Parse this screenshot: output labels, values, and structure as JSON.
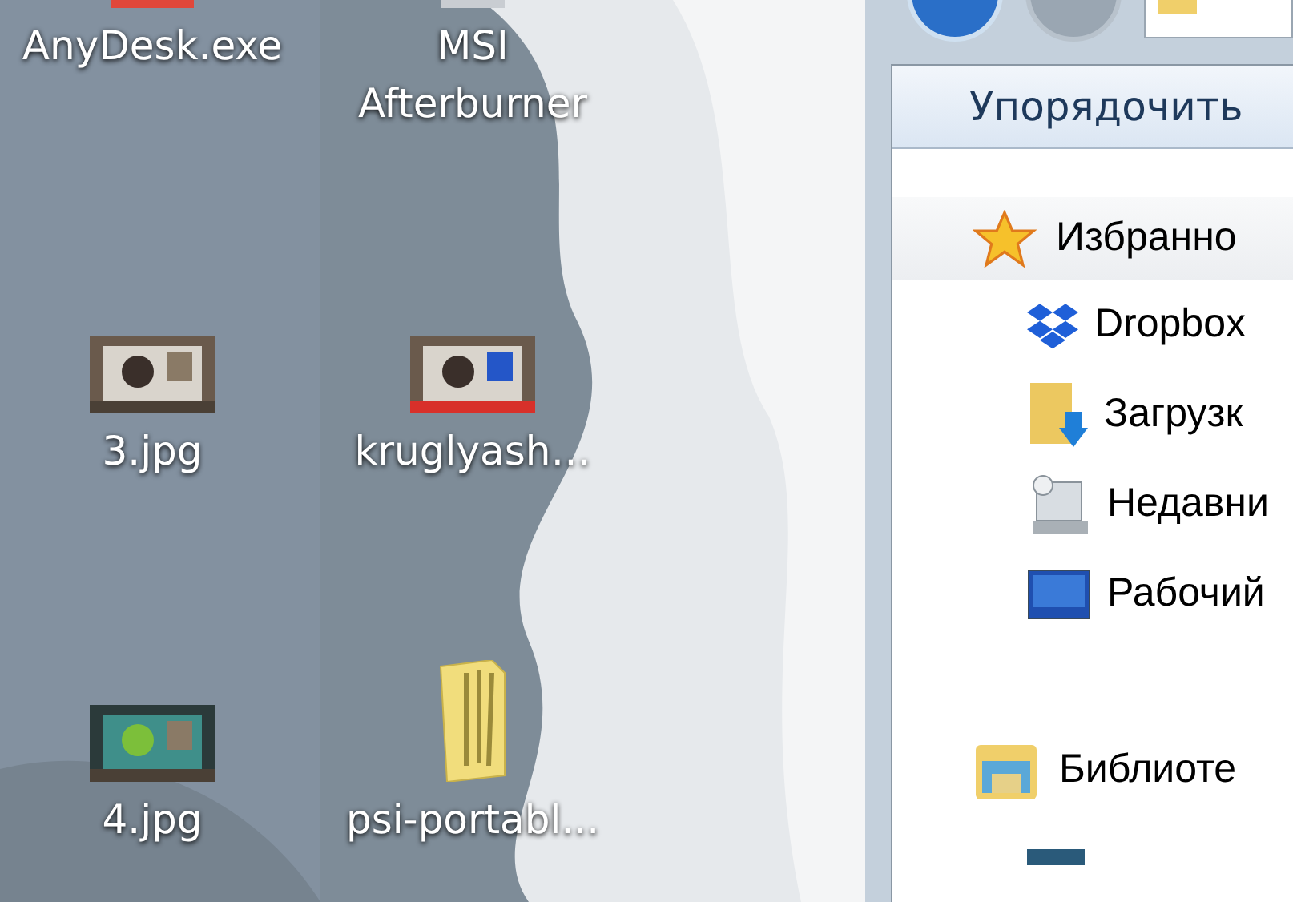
{
  "desktop": {
    "icons": [
      {
        "label": "AnyDesk.exe",
        "kind": "app"
      },
      {
        "label": "MSI Afterburner",
        "kind": "app"
      },
      {
        "label": "3.jpg"
      },
      {
        "label": "kruglyash…"
      },
      {
        "label": "4.jpg"
      },
      {
        "label": "psi-portabl...",
        "kind": "folder"
      }
    ]
  },
  "explorer": {
    "toolbar": {
      "organize": "Упорядочить"
    },
    "navigation": [
      {
        "label": "Избранно",
        "children": [
          {
            "label": "Dropbox",
            "kind": "item"
          },
          {
            "label": "Загрузк",
            "kind": "item"
          },
          {
            "label": "Недавни",
            "kind": "item"
          },
          {
            "label": "Рабочий",
            "kind": "item"
          }
        ]
      },
      {
        "label": "Библиоте",
        "children": [
          {
            "kind": "icon-only"
          }
        ]
      }
    ]
  }
}
